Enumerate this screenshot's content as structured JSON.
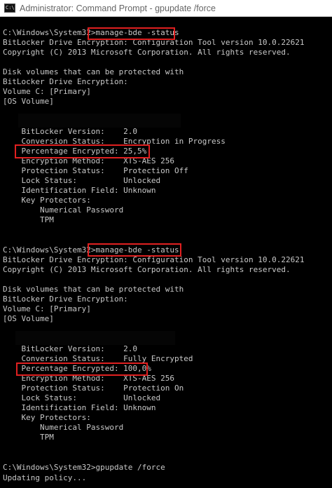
{
  "window": {
    "title": "Administrator: Command Prompt - gpupdate  /force",
    "icon": "cmd-icon",
    "icon_text": "C:\\."
  },
  "colors": {
    "background": "#000000",
    "text": "#c8c8c8",
    "highlight": "#e02020"
  },
  "lines": [
    "C:\\Windows\\System32>manage-bde -status",
    "BitLocker Drive Encryption: Configuration Tool version 10.0.22621",
    "Copyright (C) 2013 Microsoft Corporation. All rights reserved.",
    "",
    "Disk volumes that can be protected with",
    "BitLocker Drive Encryption:",
    "Volume C: [Primary]",
    "[OS Volume]",
    "",
    "",
    "",
    "    BitLocker Version:    2.0",
    "    Conversion Status:    Encryption in Progress",
    "    Percentage Encrypted: 25,5%",
    "    Encryption Method:    XTS-AES 256",
    "    Protection Status:    Protection Off",
    "    Lock Status:          Unlocked",
    "    Identification Field: Unknown",
    "    Key Protectors:",
    "        Numerical Password",
    "        TPM",
    "",
    "",
    "C:\\Windows\\System32>manage-bde -status",
    "BitLocker Drive Encryption: Configuration Tool version 10.0.22621",
    "Copyright (C) 2013 Microsoft Corporation. All rights reserved.",
    "",
    "Disk volumes that can be protected with",
    "BitLocker Drive Encryption:",
    "Volume C: [Primary]",
    "[OS Volume]",
    "",
    "",
    "",
    "    BitLocker Version:    2.0",
    "    Conversion Status:    Fully Encrypted",
    "    Percentage Encrypted: 100,0%",
    "    Encryption Method:    XTS-AES 256",
    "    Protection Status:    Protection On",
    "    Lock Status:          Unlocked",
    "    Identification Field: Unknown",
    "    Key Protectors:",
    "        Numerical Password",
    "        TPM",
    "",
    "",
    "C:\\Windows\\System32>gpupdate /force",
    "Updating policy..."
  ]
}
